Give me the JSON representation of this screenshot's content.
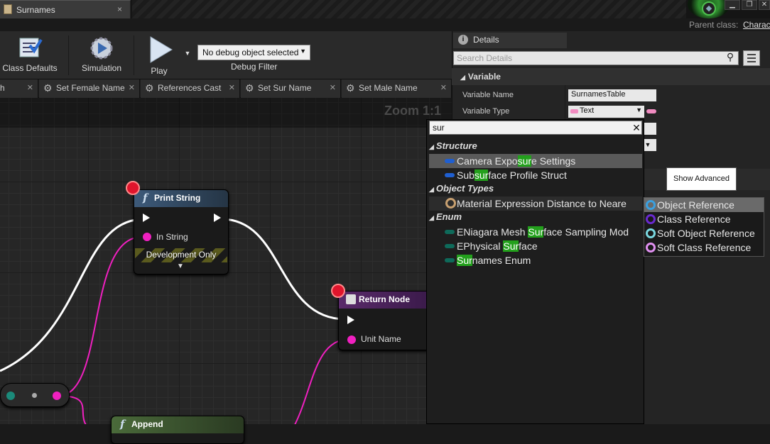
{
  "window": {
    "tab_title": "Surnames",
    "tab_close": "×",
    "parent_class_label": "Parent class:",
    "parent_class_value": "Charac"
  },
  "toolbar": {
    "class_defaults": "Class Defaults",
    "simulation": "Simulation",
    "play": "Play",
    "debug_object": "No debug object selected",
    "debug_filter": "Debug Filter"
  },
  "function_tabs": [
    {
      "label": "h"
    },
    {
      "label": "Set Female Name"
    },
    {
      "label": "References Cast"
    },
    {
      "label": "Set Sur Name"
    },
    {
      "label": "Set Male Name"
    }
  ],
  "graph": {
    "zoom": "Zoom 1:1",
    "nodes": {
      "print_string": {
        "title": "Print String",
        "pin_in_string": "In String",
        "dev_only": "Development Only"
      },
      "return_node": {
        "title": "Return Node",
        "pin_unit_name": "Unit Name"
      },
      "append": {
        "title": "Append"
      }
    }
  },
  "details": {
    "tab_label": "Details",
    "search_placeholder": "Search Details",
    "section_variable": "Variable",
    "variable_name_label": "Variable Name",
    "variable_name_value": "SurnamesTable",
    "variable_type_label": "Variable Type",
    "variable_type_value": "Text",
    "show_advanced": "Show Advanced"
  },
  "type_picker": {
    "search_value": "sur",
    "categories": {
      "structure": "Structure",
      "object_types": "Object Types",
      "enum": "Enum"
    },
    "items": {
      "camera": [
        "Camera Expo",
        "sur",
        "e Settings"
      ],
      "subsurface": [
        "Sub",
        "sur",
        "face Profile Struct"
      ],
      "material": [
        "Material Expression Distance to Neare"
      ],
      "niagara": [
        "ENiagara Mesh ",
        "Sur",
        "face Sampling Mod"
      ],
      "physical": [
        "EPhysical ",
        "Sur",
        "face"
      ],
      "surnames": [
        "",
        "Sur",
        "names Enum"
      ]
    },
    "submenu": [
      "Object Reference",
      "Class Reference",
      "Soft Object Reference",
      "Soft Class Reference"
    ]
  },
  "colors": {
    "text_pin": "#f08bc0",
    "string_pin": "#f020c0",
    "struct_icon": "#1f5fd0",
    "enum_icon": "#0e6a5a",
    "highlight": "#23a01c",
    "function_header": "#3d5a7a",
    "return_header": "#5a2a6a"
  }
}
